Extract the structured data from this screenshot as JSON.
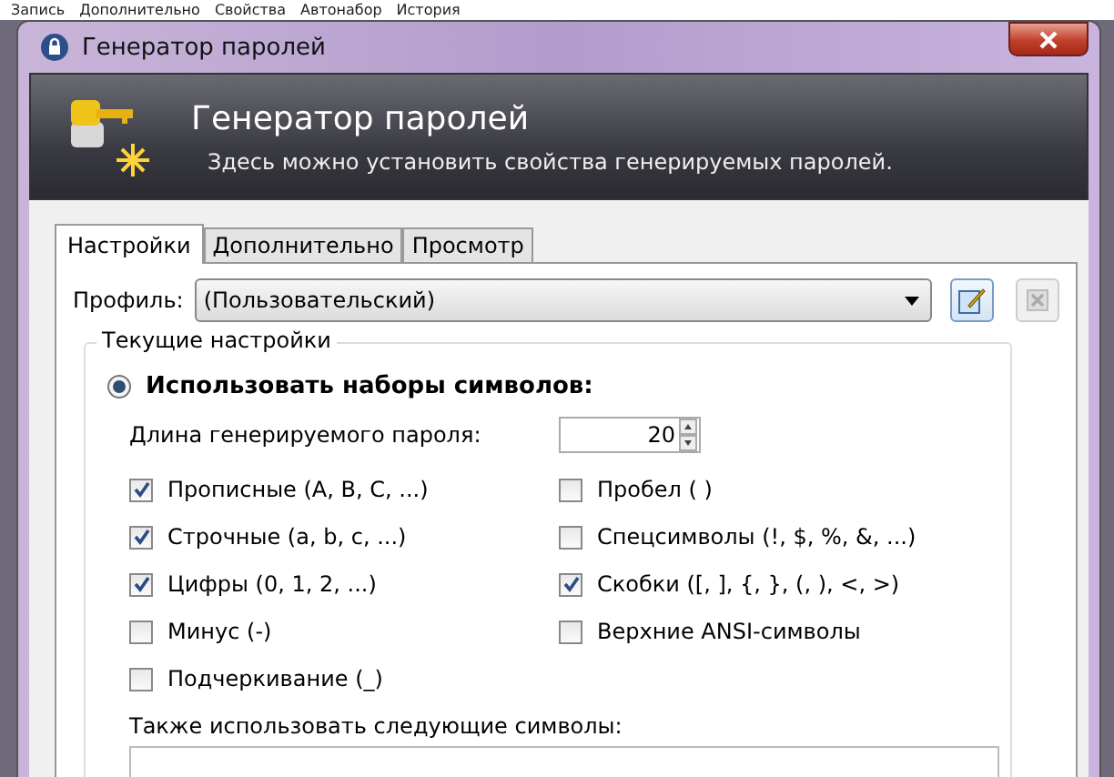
{
  "background_menu": [
    "Запись",
    "Дополнительно",
    "Свойства",
    "Автонабор",
    "История"
  ],
  "window": {
    "title": "Генератор паролей"
  },
  "header": {
    "title": "Генератор паролей",
    "subtitle": "Здесь можно установить свойства генерируемых паролей."
  },
  "tabs": [
    {
      "label": "Настройки",
      "selected": true
    },
    {
      "label": "Дополнительно",
      "selected": false
    },
    {
      "label": "Просмотр",
      "selected": false
    }
  ],
  "profile": {
    "label": "Профиль:",
    "value": "(Пользовательский)"
  },
  "group": {
    "title": "Текущие настройки",
    "mode": {
      "label": "Использовать наборы символов:",
      "selected": true
    },
    "length": {
      "label": "Длина генерируемого пароля:",
      "value": "20"
    },
    "options_left": [
      {
        "label": "Прописные (A, B, C, ...)",
        "checked": true
      },
      {
        "label": "Строчные (a, b, c, ...)",
        "checked": true
      },
      {
        "label": "Цифры (0, 1, 2, ...)",
        "checked": true
      },
      {
        "label": "Минус (-)",
        "checked": false
      },
      {
        "label": "Подчеркивание (_)",
        "checked": false
      }
    ],
    "options_right": [
      {
        "label": "Пробел ( )",
        "checked": false
      },
      {
        "label": "Спецсимволы (!, $, %, &, ...)",
        "checked": false
      },
      {
        "label": "Скобки ([, ], {, }, (, ), <, >)",
        "checked": true
      },
      {
        "label": "Верхние ANSI-символы",
        "checked": false
      }
    ],
    "extra": {
      "label": "Также использовать следующие символы:"
    }
  }
}
